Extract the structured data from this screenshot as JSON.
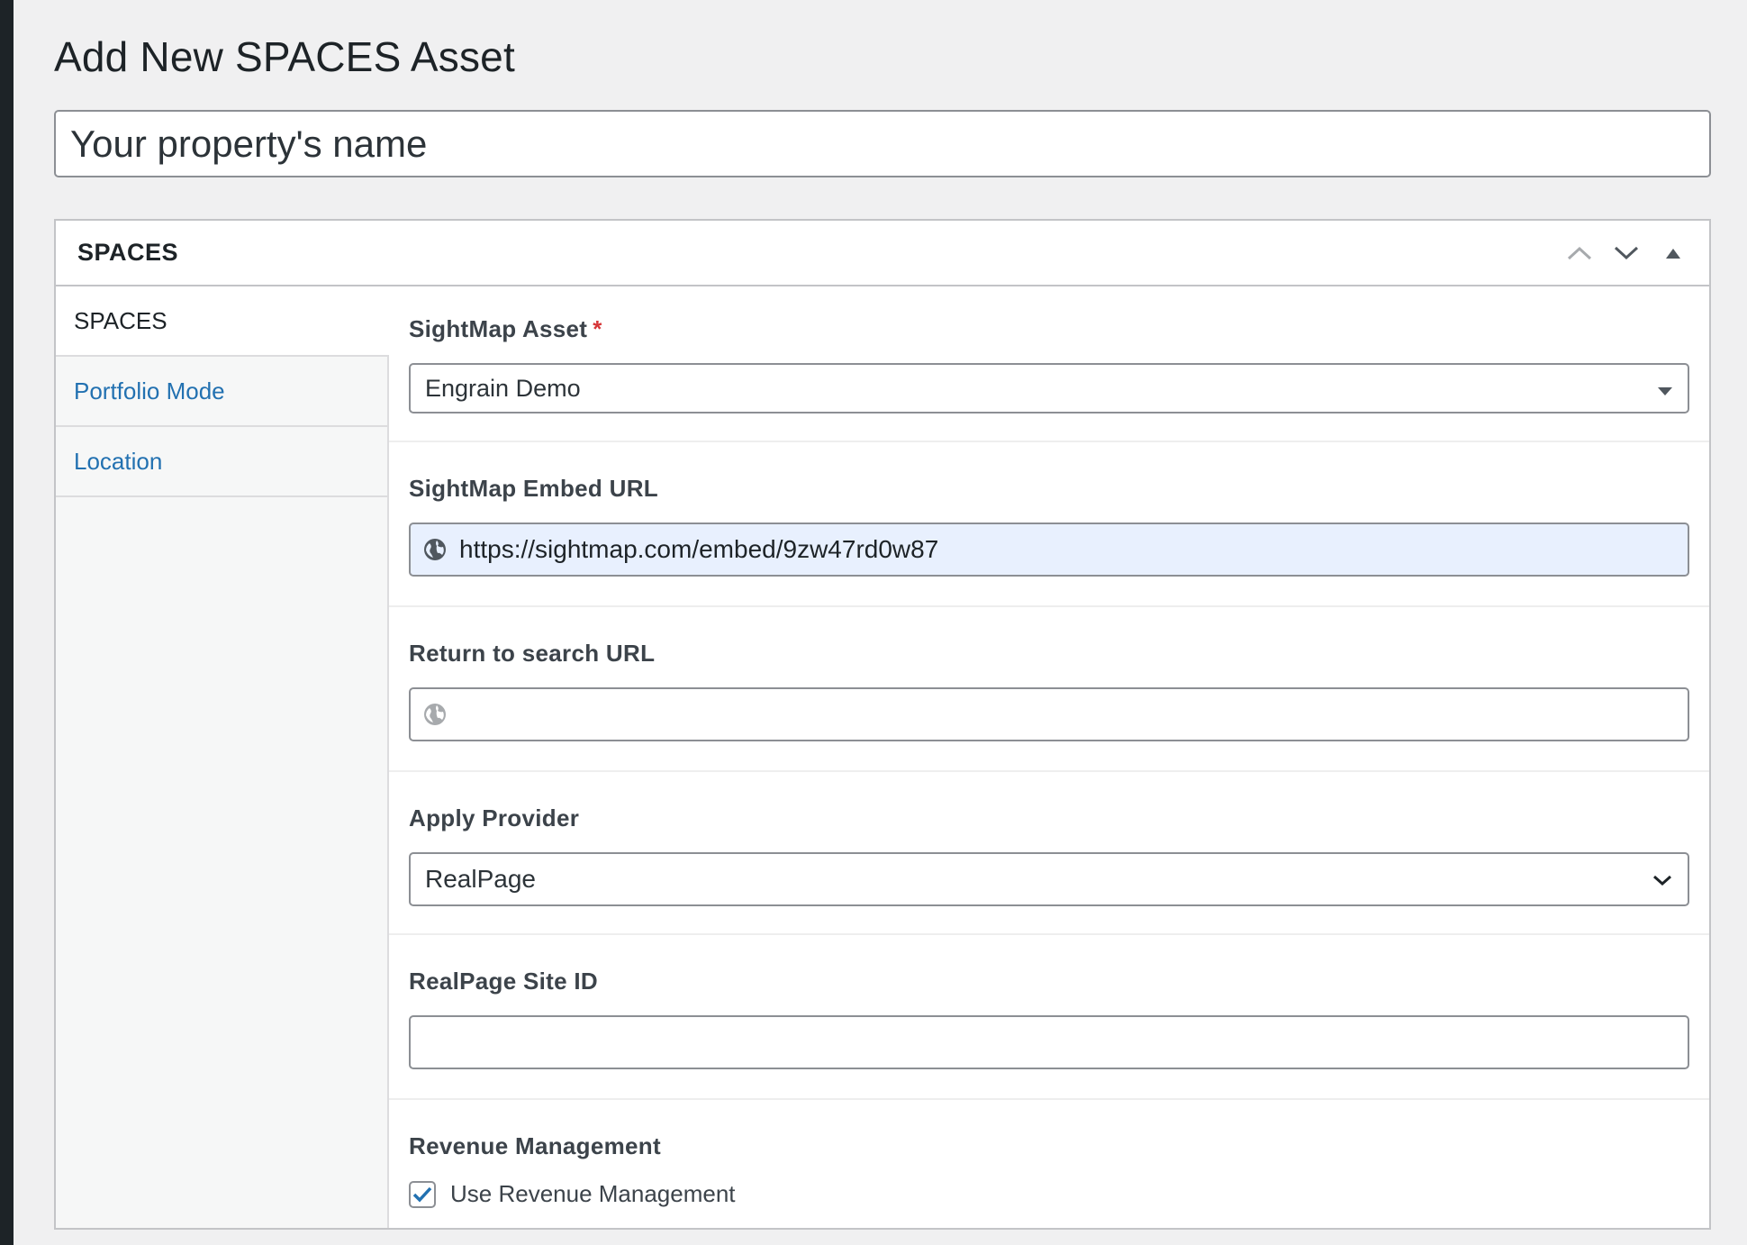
{
  "page": {
    "title": "Add New SPACES Asset",
    "title_placeholder": "Your property's name"
  },
  "metabox": {
    "title": "SPACES",
    "controls": [
      "move-up-icon",
      "move-down-icon",
      "toggle-panel-icon"
    ]
  },
  "tabs": [
    {
      "label": "SPACES",
      "active": true
    },
    {
      "label": "Portfolio Mode",
      "active": false
    },
    {
      "label": "Location",
      "active": false
    }
  ],
  "fields": {
    "sightmap_asset": {
      "label": "SightMap Asset",
      "required_mark": "*",
      "value": "Engrain Demo"
    },
    "embed_url": {
      "label": "SightMap Embed URL",
      "value": "https://sightmap.com/embed/9zw47rd0w87",
      "icon": "globe-icon"
    },
    "return_url": {
      "label": "Return to search URL",
      "value": "",
      "icon": "globe-icon"
    },
    "apply_provider": {
      "label": "Apply Provider",
      "value": "RealPage"
    },
    "realpage_site_id": {
      "label": "RealPage Site ID",
      "value": ""
    },
    "revenue_management": {
      "label": "Revenue Management",
      "checkbox_label": "Use Revenue Management",
      "checked": true
    }
  },
  "colors": {
    "link": "#2271b1",
    "required": "#d63638",
    "autofill_bg": "#e8f0fe",
    "checkmark": "#2271b1"
  }
}
